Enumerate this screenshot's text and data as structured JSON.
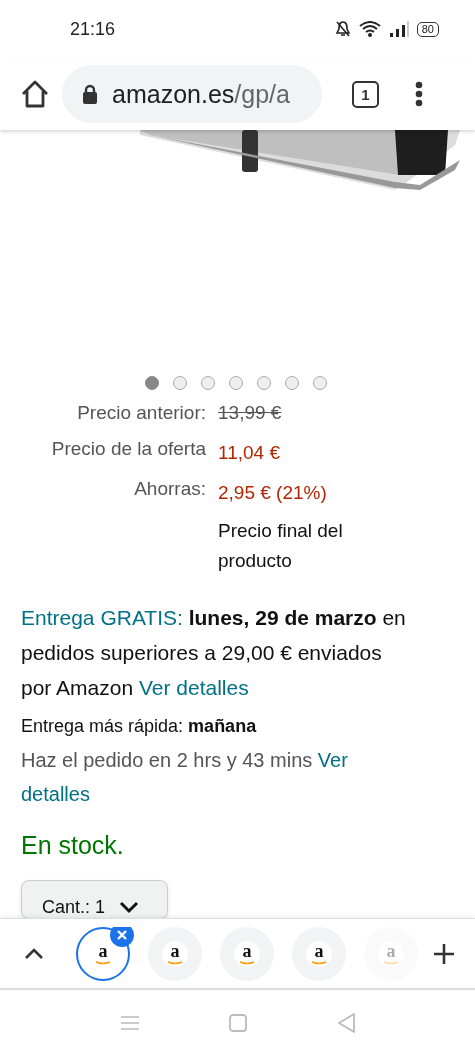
{
  "status_bar": {
    "time": "21:16",
    "battery": "80"
  },
  "toolbar": {
    "url_host": "amazon.es",
    "url_path": "/gp/a",
    "tab_count": "1"
  },
  "carousel": {
    "dots": [
      {
        "selected": true
      },
      {
        "selected": false
      },
      {
        "selected": false
      },
      {
        "selected": false
      },
      {
        "selected": false
      },
      {
        "selected": false
      },
      {
        "selected": false
      }
    ]
  },
  "prices": [
    {
      "label": "Precio anterior:",
      "value": "13,99 €",
      "kind": "struck"
    },
    {
      "label": "Precio de la oferta",
      "value": "11,04 €",
      "kind": "deal"
    },
    {
      "label": "Ahorras:",
      "value": "2,95 € (21%)",
      "kind": "deal"
    },
    {
      "value": "Precio final del producto",
      "kind": "note"
    }
  ],
  "delivery": {
    "free_label": "Entrega GRATIS:",
    "date": "lunes, 29 de marzo",
    "conditions": "en pedidos superiores a 29,00 € enviados por Amazon",
    "details_link": "Ver detalles"
  },
  "fast_delivery": {
    "label": "Entrega más rápida:",
    "date": "mañana",
    "countdown": "Haz el pedido en 2 hrs y 43 mins",
    "details_link": "Ver detalles"
  },
  "availability": "En stock.",
  "quantity": {
    "label": "Cant.:",
    "value": "1"
  },
  "tab_strip": {
    "tabs": [
      {
        "favicon": "a",
        "selected": true
      },
      {
        "favicon": "a",
        "selected": false
      },
      {
        "favicon": "a",
        "selected": false
      },
      {
        "favicon": "a",
        "selected": false
      },
      {
        "favicon": "a",
        "selected": false,
        "kind": "faded"
      }
    ]
  }
}
